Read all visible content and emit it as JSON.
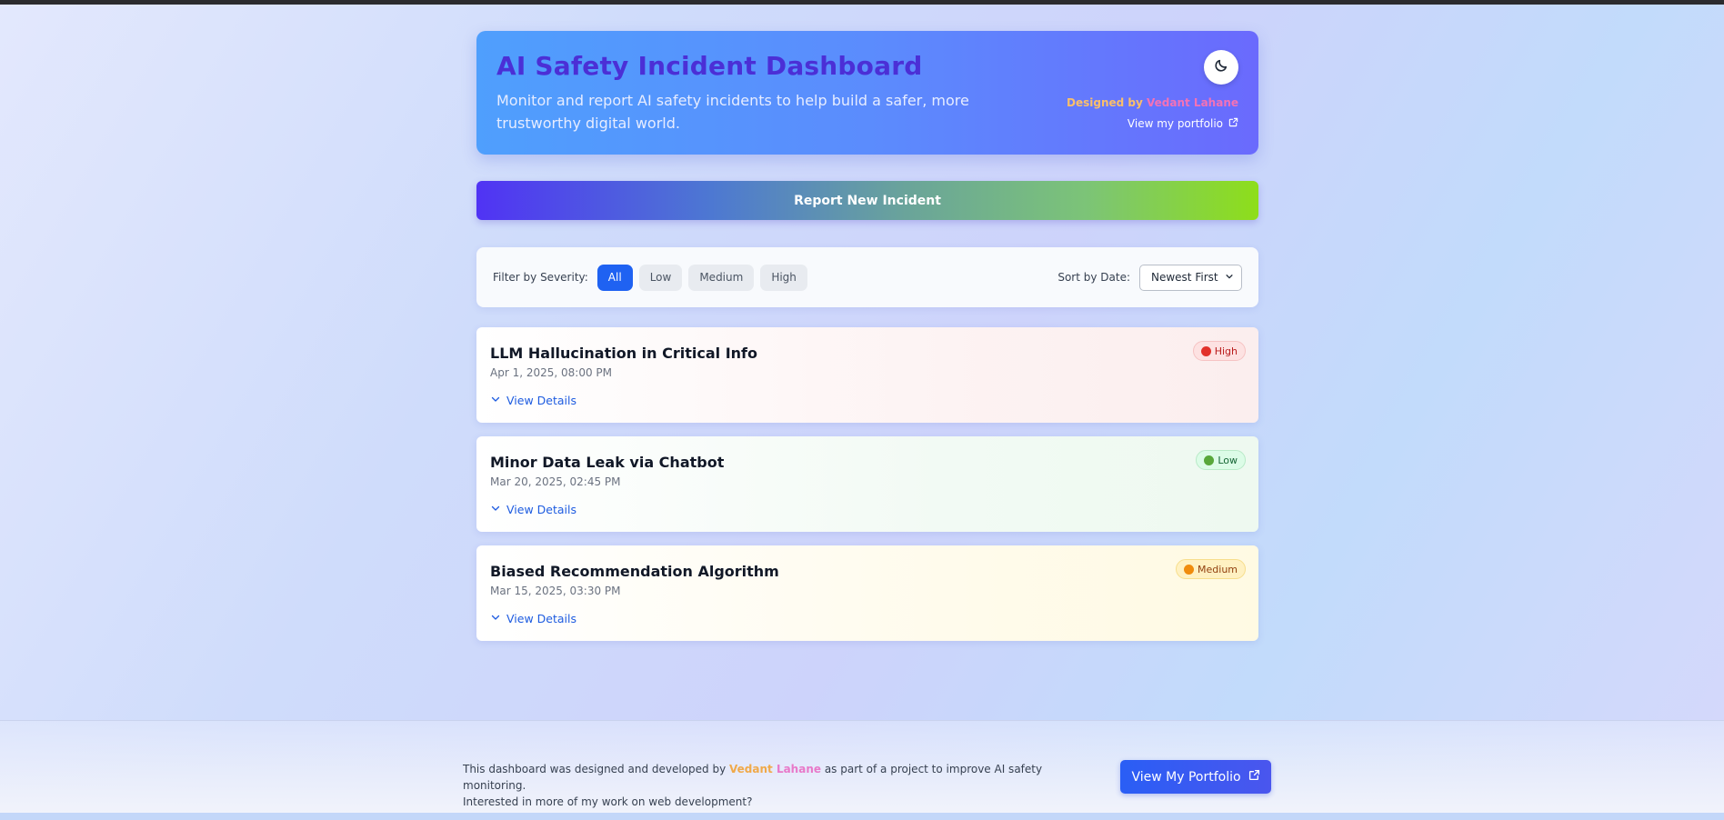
{
  "header": {
    "title": "AI Safety Incident Dashboard",
    "subtitle": "Monitor and report AI safety incidents to help build a safer, more trustworthy digital world.",
    "credit_prefix": "Designed by ",
    "credit_name": "Vedant Lahane",
    "portfolio_link": "View my portfolio",
    "theme_icon": "moon-icon"
  },
  "report_button": "Report New Incident",
  "filters": {
    "label": "Filter by Severity:",
    "options": [
      "All",
      "Low",
      "Medium",
      "High"
    ],
    "active": "All",
    "sort_label": "Sort by Date:",
    "sort_value": "Newest First"
  },
  "incidents": [
    {
      "title": "LLM Hallucination in Critical Info",
      "date": "Apr 1, 2025, 08:00 PM",
      "severity": "High",
      "details_label": "View Details",
      "color": "#e2302a"
    },
    {
      "title": "Minor Data Leak via Chatbot",
      "date": "Mar 20, 2025, 02:45 PM",
      "severity": "Low",
      "details_label": "View Details",
      "color": "#58a83a"
    },
    {
      "title": "Biased Recommendation Algorithm",
      "date": "Mar 15, 2025, 03:30 PM",
      "severity": "Medium",
      "details_label": "View Details",
      "color": "#f08c0c"
    }
  ],
  "footer": {
    "text_before": "This dashboard was designed and developed by ",
    "name_first": "Vedant ",
    "name_last": "Lahane",
    "text_after": " as part of a project to improve AI safety monitoring.",
    "text_line2": "Interested in more of my work on web development?",
    "button": "View My Portfolio"
  },
  "colors": {
    "accent": "#1f62f2",
    "title": "#4b2fd6",
    "credit": "#fbbf6a",
    "credit_name": "#f472b6"
  }
}
